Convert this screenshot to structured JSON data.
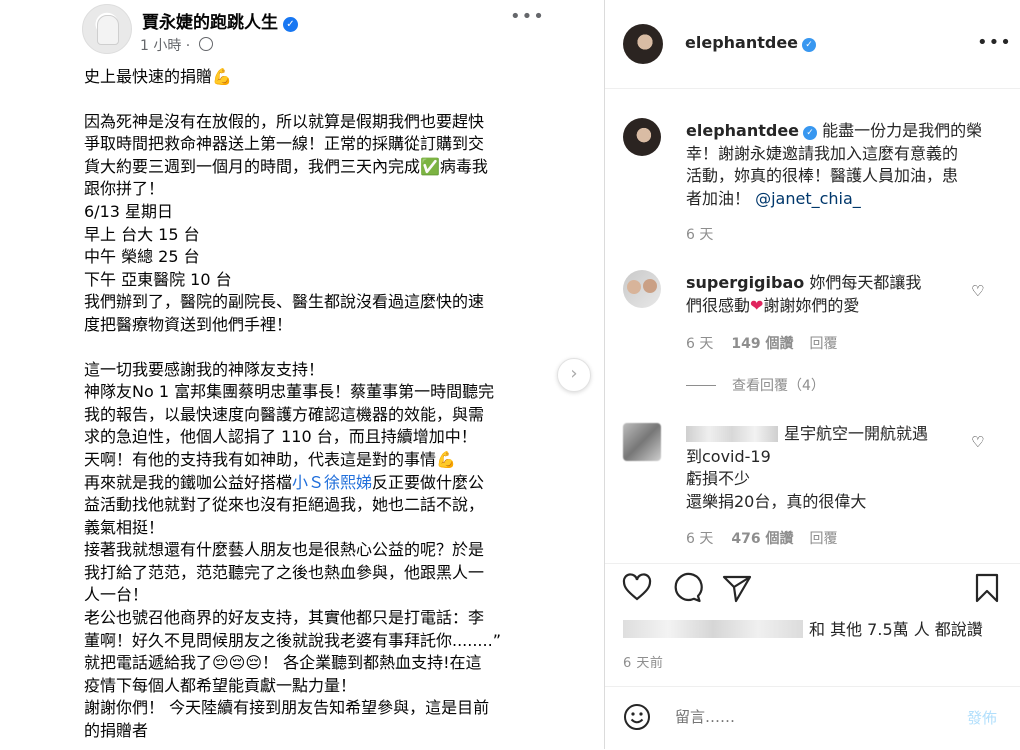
{
  "facebook_post": {
    "author": "賈永婕的跑跳人生",
    "time": "1 小時",
    "paragraphs": [
      "史上最快速的捐贈💪",
      "",
      "因為死神是沒有在放假的，所以就算是假期我們也要趕快",
      "爭取時間把救命神器送上第一線！正常的採購從訂購到交",
      "貨大約要三週到一個月的時間，我們三天內完成✅病毒我",
      "跟你拼了！",
      "6/13 星期日",
      "早上 台大 15 台",
      "中午 榮總 25 台",
      "下午 亞東醫院 10 台",
      "我們辦到了，醫院的副院長、醫生都說沒看過這麼快的速",
      "度把醫療物資送到他們手裡！",
      "",
      "這一切我要感謝我的神隊友支持！",
      "神隊友No 1 富邦集團蔡明忠董事長！蔡董事第一時間聽完",
      "我的報告，以最快速度向醫護方確認這機器的效能，與需",
      "求的急迫性，他個人認捐了 110 台，而且持續增加中！",
      "天啊！有他的支持我有如神助，代表這是對的事情💪",
      "再來就是我的鐵咖公益好搭檔小Ｓ徐熙娣反正要做什麼公",
      "益活動找他就對了從來也沒有拒絕過我，她也二話不說，",
      "義氣相挺！",
      "接著我就想還有什麼藝人朋友也是很熱心公益的呢？於是",
      "我打給了范范，范范聽完了之後也熱血參與，他跟黑人一",
      "人一台！",
      "老公也號召他商界的好友支持，其實他都只是打電話：李",
      "董啊！好久不見問候朋友之後就說我老婆有事拜託你........”",
      "就把電話遞給我了😔😔😔！ 各企業聽到都熱血支持!在這",
      "疫情下每個人都希望能貢獻一點力量！",
      "謝謝你們！ 今天陸續有接到朋友告知希望參與，這是目前",
      "的捐贈者"
    ],
    "link_text": "小Ｓ徐熙娣"
  },
  "instagram": {
    "username": "elephantdee",
    "caption": {
      "user": "elephantdee",
      "lines": [
        "能盡一份力是我們的榮",
        "幸！謝謝永婕邀請我加入這麼有意義的",
        "活動，妳真的很棒！醫護人員加油，患",
        "者加油！"
      ],
      "mention": "@janet_chia_",
      "time": "6 天"
    },
    "comments": [
      {
        "user": "supergigibao",
        "lines": [
          "妳們每天都讓我",
          "們很感動",
          "謝謝妳們的愛"
        ],
        "time": "6 天",
        "likes": "149 個讚",
        "reply": "回覆"
      },
      {
        "user": "",
        "lines": [
          "星宇航空一開航就遇",
          "到covid-19",
          "虧損不少",
          "還樂捐20台，真的很偉大"
        ],
        "time": "6 天",
        "likes": "476 個讚",
        "reply": "回覆"
      }
    ],
    "view_replies": "查看回覆（4）",
    "likes_summary": "和 其他 7.5萬 人 都說讚",
    "posted_ago": "6 天前",
    "comment_placeholder": "留言……",
    "post_button": "發佈"
  },
  "colors": {
    "ig_blue": "#3897f0",
    "fb_blue": "#1877f2",
    "link": "#216fdb"
  }
}
